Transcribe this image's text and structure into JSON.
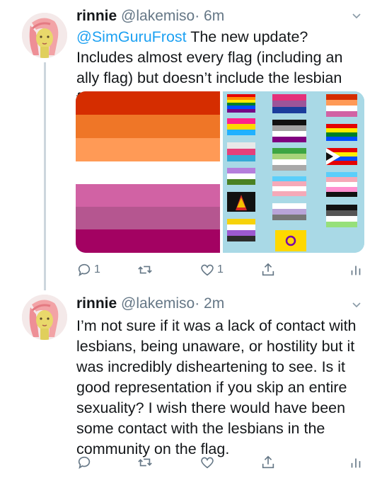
{
  "tweets": [
    {
      "name": "rinnie",
      "handle": "@lakemiso",
      "time": "· 6m",
      "mention": "@SimGuruFrost",
      "text": " The new update? Includes almost every flag (including an ally flag) but doesn’t include the lesbian flag?",
      "replies": "1",
      "likes": "1"
    },
    {
      "name": "rinnie",
      "handle": "@lakemiso",
      "time": "· 2m",
      "text": "I’m not sure if it was a lack of contact with lesbians, being unaware, or hostility but it was incredibly disheartening to see. Is it good representation if you skip an entire sexuality? I wish there would have been some contact with the lesbians in the community on the flag."
    }
  ],
  "media": {
    "lesbian_flag_colors": [
      "#d52d00",
      "#ef7627",
      "#ff9a56",
      "#ffffff",
      "#d162a4",
      "#b55690",
      "#a30262"
    ],
    "wall_background": "#a9d9e6"
  },
  "icons": [
    "reply-icon",
    "retweet-icon",
    "like-icon",
    "share-icon",
    "analytics-icon",
    "chevron-down-icon"
  ]
}
